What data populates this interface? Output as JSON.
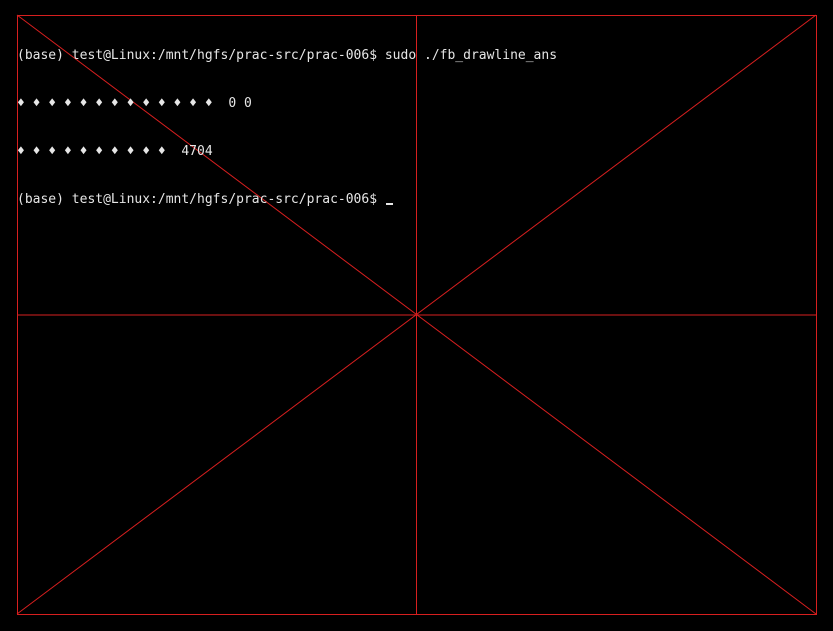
{
  "colors": {
    "background": "#000000",
    "line_color": "#d71f1f",
    "text_color": "#e6e6e6"
  },
  "terminal": {
    "lines": [
      "(base) test@Linux:/mnt/hgfs/prac-src/prac-006$ sudo ./fb_drawline_ans",
      "♦ ♦ ♦ ♦ ♦ ♦ ♦ ♦ ♦ ♦ ♦ ♦ ♦  0 0",
      "♦ ♦ ♦ ♦ ♦ ♦ ♦ ♦ ♦ ♦  4704",
      "(base) test@Linux:/mnt/hgfs/prac-src/prac-006$ "
    ],
    "cursor_visible": true
  },
  "drawing": {
    "description_lines": [
      "border",
      "horizontal-center",
      "vertical-center",
      "diagonal-main",
      "diagonal-anti"
    ]
  }
}
